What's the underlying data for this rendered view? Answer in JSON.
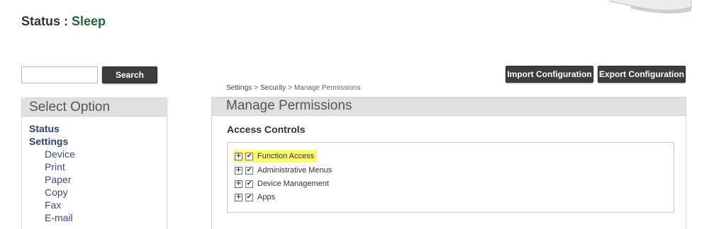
{
  "status": {
    "label": "Status : ",
    "value": "Sleep"
  },
  "search": {
    "value": "",
    "button_label": "Search"
  },
  "toolbar": {
    "import_label": "Import Configuration",
    "export_label": "Export Configuration"
  },
  "breadcrumb": {
    "items": [
      "Settings",
      "Security",
      "Manage Permissions"
    ],
    "separator": ">"
  },
  "sidebar": {
    "title": "Select Option",
    "top_items": [
      {
        "label": "Status"
      },
      {
        "label": "Settings"
      }
    ],
    "sub_items": [
      {
        "label": "Device"
      },
      {
        "label": "Print"
      },
      {
        "label": "Paper"
      },
      {
        "label": "Copy"
      },
      {
        "label": "Fax"
      },
      {
        "label": "E-mail"
      }
    ]
  },
  "main": {
    "title": "Manage Permissions",
    "section_title": "Access Controls",
    "tree": [
      {
        "label": "Function Access",
        "checked": true,
        "highlighted": true
      },
      {
        "label": "Administrative Menus",
        "checked": true,
        "highlighted": false
      },
      {
        "label": "Device Management",
        "checked": true,
        "highlighted": false
      },
      {
        "label": "Apps",
        "checked": true,
        "highlighted": false
      }
    ]
  },
  "colors": {
    "status_value": "#1e6b34",
    "button_bg": "#3d3d3d",
    "panel_header_bg": "#e0e0e0",
    "nav_link": "#2b3e7a",
    "highlight": "#fafa6a"
  },
  "icons": {
    "expander": "plus-box-icon",
    "checkbox": "checkmark-icon"
  }
}
